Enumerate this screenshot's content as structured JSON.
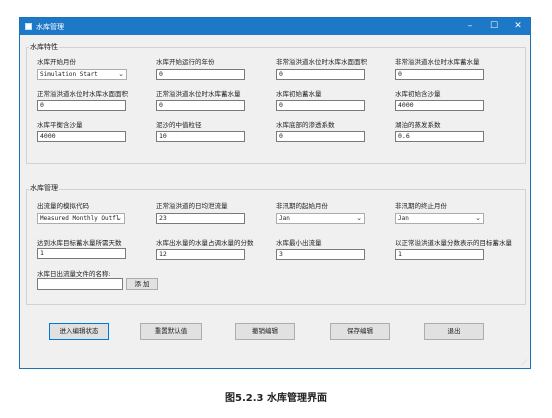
{
  "window": {
    "title": "水库管理",
    "minimize": "–",
    "maximize": "☐",
    "close": "✕"
  },
  "reservoir_props": {
    "title": "水库特性",
    "start_month_label": "水库开始月份",
    "start_month_value": "Simulation Start",
    "start_year_label": "水库开始运行的年份",
    "start_year_value": "0",
    "abnormal_area_label": "非常溢洪道水位时水库水面面积",
    "abnormal_area_value": "0",
    "abnormal_storage_label": "非常溢洪道水位时水库蓄水量",
    "abnormal_storage_value": "0",
    "normal_area_label": "正常溢洪道水位时水库水面面积",
    "normal_area_value": "0",
    "normal_storage_label": "正常溢洪道水位时水库蓄水量",
    "normal_storage_value": "0",
    "initial_storage_label": "水库初始蓄水量",
    "initial_storage_value": "0",
    "initial_sediment_label": "水库初始含沙量",
    "initial_sediment_value": "4000",
    "equil_sediment_label": "水库平衡含沙量",
    "equil_sediment_value": "4000",
    "median_particle_label": "泥沙的中值粒径",
    "median_particle_value": "10",
    "bottom_k_label": "水库底部的渗透系数",
    "bottom_k_value": "0",
    "lake_evap_label": "湖泊的蒸发系数",
    "lake_evap_value": "0.6"
  },
  "reservoir_mgmt": {
    "title": "水库管理",
    "outflow_method_label": "出流量的模拟代码",
    "outflow_method_value": "Measured Monthly Outfl",
    "normal_release_label": "正常溢洪道的日均泄流量",
    "normal_release_value": "23",
    "nonflood_start_label": "非汛期的起始月份",
    "nonflood_start_value": "Jan",
    "nonflood_end_label": "非汛期的终止月份",
    "nonflood_end_value": "Jan",
    "target_days_label": "达到水库目标蓄水量所需天数",
    "target_days_value": "1",
    "outflow_fraction_label": "水库出水量的水量占调水量的分数",
    "outflow_fraction_value": "12",
    "min_outflow_label": "水库最小出流量",
    "min_outflow_value": "3",
    "target_fraction_label": "以正常溢洪道水量分数表示的目标蓄水量",
    "target_fraction_value": "1",
    "daily_file_label": "水库日出流量文件的名称:",
    "daily_file_value": "",
    "add_button": "添 加"
  },
  "actions": {
    "edit_mode": "进入编辑状态",
    "reset_default": "重置默认值",
    "cancel_edit": "撤销编辑",
    "save_edit": "保存编辑",
    "exit": "退出"
  },
  "caption": "图5.2.3 水库管理界面"
}
